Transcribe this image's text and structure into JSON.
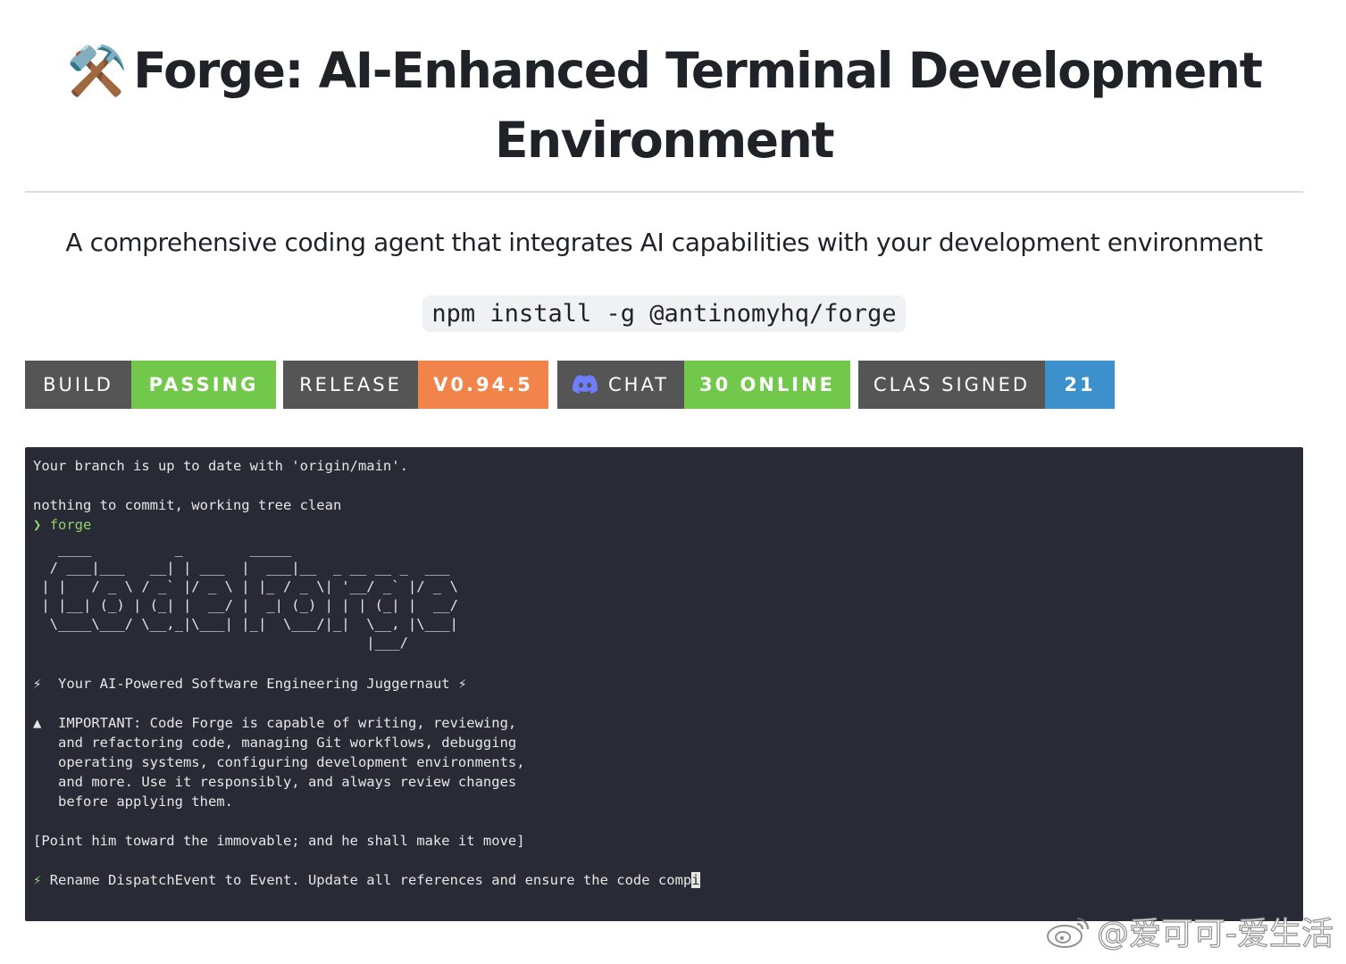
{
  "header": {
    "emoji": "⚒️",
    "title": "Forge: AI-Enhanced Terminal Development Environment"
  },
  "description": "A comprehensive coding agent that integrates AI capabilities with your development environment",
  "install_command": "npm install -g @antinomyhq/forge",
  "badges": [
    {
      "label": "BUILD",
      "value": "PASSING",
      "label_color": "#555555",
      "value_color": "#72c84a"
    },
    {
      "label": "RELEASE",
      "value": "V0.94.5",
      "label_color": "#555555",
      "value_color": "#f1844a"
    },
    {
      "label": "CHAT",
      "value": "30 ONLINE",
      "icon": "discord-icon",
      "label_color": "#555555",
      "value_color": "#72c84a"
    },
    {
      "label": "CLAS SIGNED",
      "value": "21",
      "label_color": "#555555",
      "value_color": "#3c91cd"
    }
  ],
  "terminal": {
    "background": "#282b36",
    "branch_status": "Your branch is up to date with 'origin/main'.",
    "commit_status": "nothing to commit, working tree clean",
    "prompt_symbol": "❯",
    "prompt_command": "forge",
    "ascii_logo": "   ____          _        _____\n  / ___|___   __| | ___  |  ___|__  _ __ __ _  ___\n | |   / _ \\ / _` |/ _ \\ | |_ / _ \\| '__/ _` |/ _ \\\n | |__| (_) | (_| |  __/ |  _| (_) | | | (_| |  __/\n  \\____\\___/ \\__,_|\\___| |_|  \\___/|_|  \\__, |\\___|\n                                        |___/",
    "tagline_icon": "⚡",
    "tagline": "Your AI-Powered Software Engineering Juggernaut",
    "warning_icon": "▲",
    "important_lines": [
      "IMPORTANT: Code Forge is capable of writing, reviewing,",
      "and refactoring code, managing Git workflows, debugging",
      "operating systems, configuring development environments,",
      "and more. Use it responsibly, and always review changes",
      "before applying them."
    ],
    "quote": "[Point him toward the immovable; and he shall make it move]",
    "input_icon": "⚡",
    "input_text": "Rename DispatchEvent to Event. Update all references and ensure the code comp",
    "cursor_char": "i"
  },
  "watermark": {
    "icon": "weibo-icon",
    "text": "@爱可可-爱生活"
  }
}
